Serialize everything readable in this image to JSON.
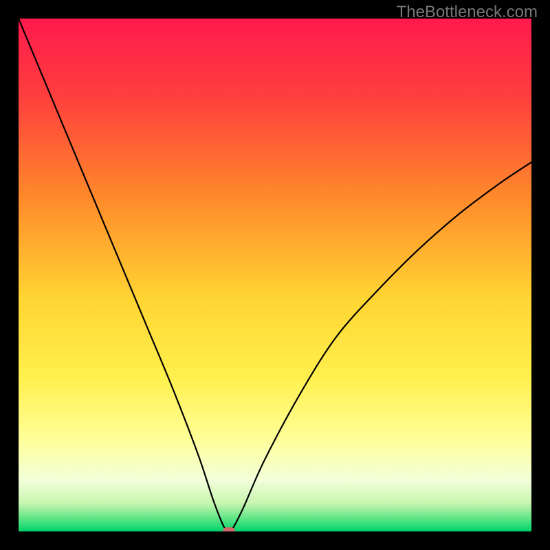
{
  "watermark": "TheBottleneck.com",
  "chart_data": {
    "type": "line",
    "title": "",
    "xlabel": "",
    "ylabel": "",
    "xlim": [
      0,
      100
    ],
    "ylim": [
      0,
      100
    ],
    "background": "vertical-gradient red→orange→yellow→pale→green",
    "curve": {
      "description": "V-shaped bottleneck curve with minimum near x≈41",
      "points_x": [
        0,
        5,
        10,
        15,
        20,
        25,
        30,
        35,
        38,
        40,
        41,
        42,
        44,
        48,
        55,
        62,
        70,
        78,
        86,
        94,
        100
      ],
      "points_y": [
        100,
        88,
        76,
        64,
        52,
        40,
        28,
        15,
        6,
        1,
        0,
        1,
        5,
        14,
        27,
        38,
        47,
        55,
        62,
        68,
        72
      ]
    },
    "marker": {
      "x": 41,
      "y": 0,
      "color": "#d46a6a"
    },
    "gradient_stops": [
      {
        "pos": 0.0,
        "color": "#ff1a4d"
      },
      {
        "pos": 0.15,
        "color": "#ff3e3e"
      },
      {
        "pos": 0.35,
        "color": "#ff8a2a"
      },
      {
        "pos": 0.55,
        "color": "#ffd633"
      },
      {
        "pos": 0.7,
        "color": "#fff04d"
      },
      {
        "pos": 0.82,
        "color": "#ffff99"
      },
      {
        "pos": 0.9,
        "color": "#f2ffd9"
      },
      {
        "pos": 0.945,
        "color": "#c8f5b0"
      },
      {
        "pos": 0.97,
        "color": "#6fe88c"
      },
      {
        "pos": 1.0,
        "color": "#00d46a"
      }
    ]
  }
}
